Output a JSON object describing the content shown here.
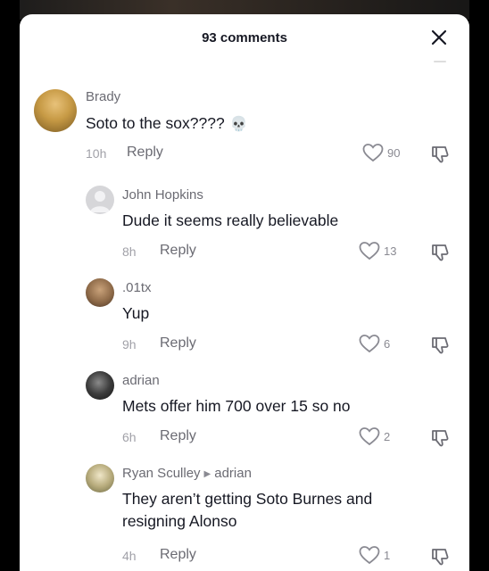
{
  "header": {
    "title": "93 comments"
  },
  "comments": [
    {
      "author": "Brady",
      "text": "Soto to the sox????",
      "emoji": "💀",
      "time": "10h",
      "reply_label": "Reply",
      "likes": "90"
    },
    {
      "author": "John Hopkins",
      "text": "Dude it seems really believable",
      "time": "8h",
      "reply_label": "Reply",
      "likes": "13"
    },
    {
      "author": ".01tx",
      "text": "Yup",
      "time": "9h",
      "reply_label": "Reply",
      "likes": "6"
    },
    {
      "author": "adrian",
      "text": "Mets offer him 700 over 15 so no",
      "time": "6h",
      "reply_label": "Reply",
      "likes": "2"
    },
    {
      "author": "Ryan Sculley",
      "reply_to": "adrian",
      "text_line1": "They aren’t getting Soto Burnes and",
      "text_line2": "resigning Alonso",
      "time": "4h",
      "reply_label": "Reply",
      "likes": "1"
    }
  ]
}
